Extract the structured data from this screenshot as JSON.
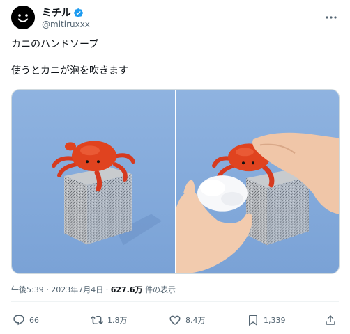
{
  "tweet": {
    "author": {
      "display_name": "ミチル",
      "handle": "@mitiruxxx",
      "verified": true,
      "verified_color": "#1d9bf0"
    },
    "text_lines": [
      "カニのハンドソープ",
      "使うとカニが泡を吹きます"
    ],
    "meta": {
      "time": "午後5:39",
      "sep1": " · ",
      "date": "2023年7月4日",
      "sep2": " · ",
      "views": "627.6万",
      "views_label": " 件の表示"
    },
    "actions": {
      "replies": "66",
      "retweets": "1.8万",
      "likes": "8.4万",
      "bookmarks": "1,339"
    },
    "icons": [
      "verified-icon",
      "more-icon",
      "reply-icon",
      "retweet-icon",
      "like-icon",
      "bookmark-icon",
      "share-icon"
    ],
    "colors": {
      "background": "#ffffff",
      "text": "#0f1419",
      "secondary": "#536471",
      "accent": "#1d9bf0",
      "border": "#cfd9de"
    }
  }
}
